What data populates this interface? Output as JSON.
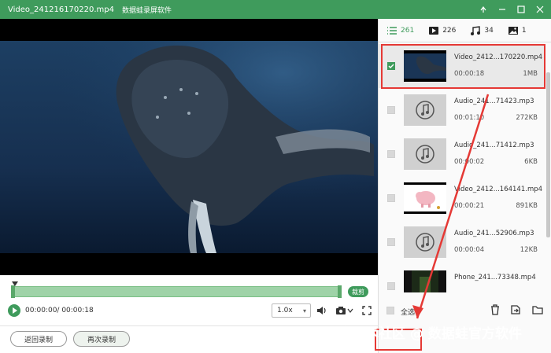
{
  "window": {
    "file_title": "Video_241216170220.mp4",
    "app_name": "数据蛙录屏软件"
  },
  "player": {
    "cut_label": "裁剪",
    "timecode": "00:00:00/ 00:00:18",
    "speed": "1.0x"
  },
  "bottom": {
    "back_label": "返回录制",
    "again_label": "再次录制"
  },
  "tabs": [
    {
      "icon": "list-icon",
      "count": "261"
    },
    {
      "icon": "video-icon",
      "count": "226"
    },
    {
      "icon": "music-icon",
      "count": "34"
    },
    {
      "icon": "image-icon",
      "count": "1"
    }
  ],
  "files": [
    {
      "name": "Video_2412...170220.mp4",
      "duration": "00:00:18",
      "size": "1MB",
      "type": "video-whale",
      "selected": true
    },
    {
      "name": "Audio_241...71423.mp3",
      "duration": "00:01:10",
      "size": "272KB",
      "type": "audio"
    },
    {
      "name": "Audio_241...71412.mp3",
      "duration": "00:00:02",
      "size": "6KB",
      "type": "audio"
    },
    {
      "name": "Video_2412...164141.mp4",
      "duration": "00:00:21",
      "size": "891KB",
      "type": "video-pig"
    },
    {
      "name": "Audio_241...52906.mp3",
      "duration": "00:00:04",
      "size": "12KB",
      "type": "audio"
    },
    {
      "name": "Phone_241...73348.mp4",
      "duration": "",
      "size": "",
      "type": "video-dark"
    }
  ],
  "footer": {
    "select_all": "全选"
  },
  "watermark": "掘金技术社区 @ 数据蛙官方软件",
  "colors": {
    "brand": "#3f9b5c",
    "highlight": "#e53935"
  }
}
